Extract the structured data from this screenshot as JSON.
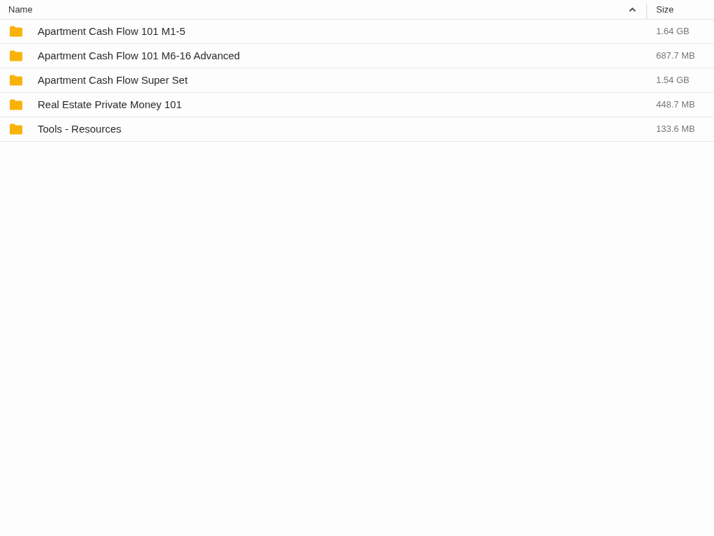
{
  "table": {
    "columns": [
      {
        "label": "Name",
        "sorted_ascending": true
      },
      {
        "label": "Size"
      }
    ],
    "rows": [
      {
        "name": "Apartment Cash Flow 101 M1-5",
        "size": "1.64 GB"
      },
      {
        "name": "Apartment Cash Flow 101 M6-16 Advanced",
        "size": "687.7 MB"
      },
      {
        "name": "Apartment Cash Flow Super Set",
        "size": "1.54 GB"
      },
      {
        "name": "Real Estate Private Money 101",
        "size": "448.7 MB"
      },
      {
        "name": "Tools - Resources",
        "size": "133.6 MB"
      }
    ]
  }
}
